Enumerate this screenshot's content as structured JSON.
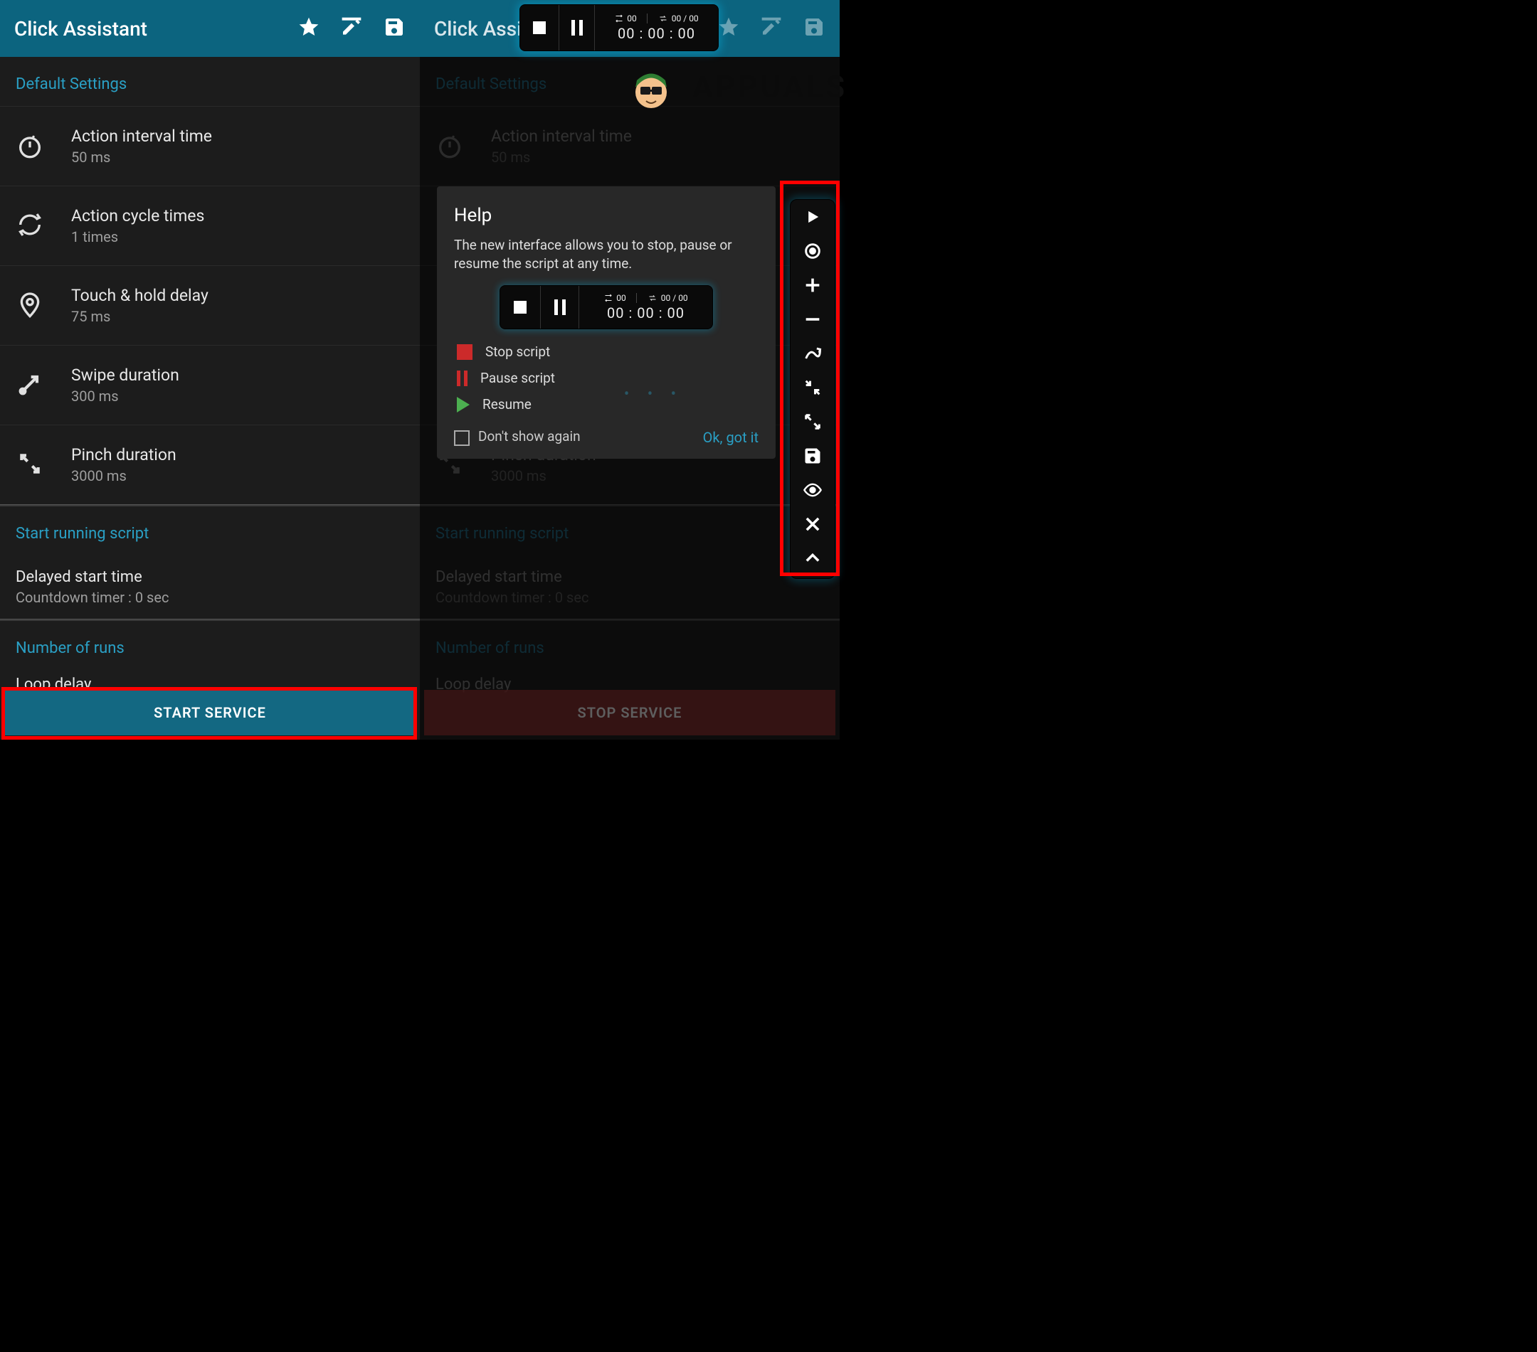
{
  "app_title": "Click Assistant",
  "sections": {
    "default_settings": "Default Settings",
    "start_running": "Start running script",
    "number_of_runs": "Number of runs"
  },
  "settings": {
    "interval": {
      "label": "Action interval time",
      "value": "50 ms"
    },
    "cycle": {
      "label": "Action cycle times",
      "value": "1 times"
    },
    "hold": {
      "label": "Touch & hold delay",
      "value": "75 ms"
    },
    "swipe": {
      "label": "Swipe duration",
      "value": "300 ms"
    },
    "pinch": {
      "label": "Pinch duration",
      "value": "3000 ms"
    }
  },
  "delayed": {
    "label": "Delayed start time",
    "value": "Countdown timer : 0 sec"
  },
  "loop_delay_label": "Loop delay",
  "start_service": "START SERVICE",
  "stop_service": "STOP SERVICE",
  "float_bar": {
    "loop_count": "00",
    "step_count": "00 / 00",
    "clock": "00 : 00 : 00"
  },
  "help": {
    "title": "Help",
    "text": "The new interface allows you to stop, pause or resume the script at any time.",
    "legend": {
      "stop": "Stop script",
      "pause": "Pause script",
      "resume": "Resume"
    },
    "dont_show": "Don't show again",
    "ok": "Ok, got it"
  },
  "watermark": "APPUALS"
}
